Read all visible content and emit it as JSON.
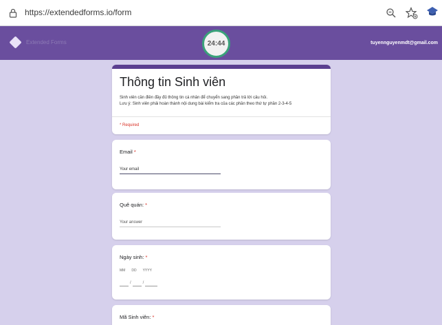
{
  "browser": {
    "url": "https://extendedforms.io/form",
    "icons": [
      "lock-icon",
      "zoom-icon",
      "favorite-icon",
      "extension-icon"
    ]
  },
  "header": {
    "app_name": "Extended Forms",
    "timer": "24:44",
    "user_email": "tuyennguyenmdt@gmail.com",
    "colors": {
      "header_bg": "#6a4e9e",
      "timer_ring": "#3aa27a",
      "page_bg": "#d6d0ec"
    }
  },
  "form": {
    "title": "Thông tin Sinh viên",
    "description_line1": "Sinh viên cần điền đầy đủ thông tin cá nhân để chuyển sang phần trả lời câu hỏi.",
    "description_line2": "Lưu ý: Sinh viên phải hoàn thành nội dung bài kiểm tra của các phần theo thứ tự phần 2-3-4-5",
    "required_note": "* Required",
    "questions": [
      {
        "label": "Email",
        "required_mark": " *",
        "placeholder": "Your email"
      },
      {
        "label": "Quê quán:",
        "required_mark": " *",
        "placeholder": "Your answer"
      },
      {
        "label": "Ngày sinh:",
        "required_mark": " *",
        "date_labels": [
          "MM",
          "DD",
          "YYYY"
        ],
        "date_separator": "/"
      },
      {
        "label": "Mã Sinh viên:",
        "required_mark": " *"
      }
    ]
  }
}
